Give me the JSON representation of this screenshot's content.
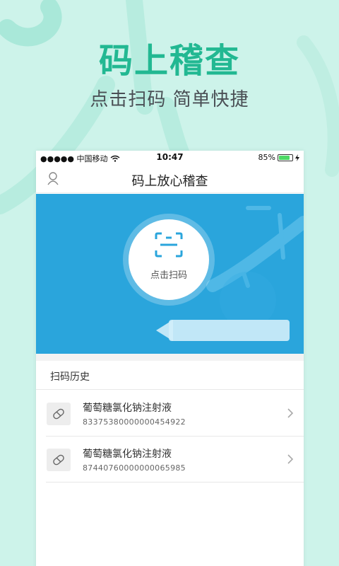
{
  "hero": {
    "title": "码上稽查",
    "subtitle": "点击扫码  简单快捷"
  },
  "status_bar": {
    "carrier": "●●●●● 中国移动",
    "time": "10:47",
    "battery": "85%",
    "battery_level": 0.85
  },
  "nav": {
    "title": "码上放心稽查",
    "user_icon": "user-icon"
  },
  "scan": {
    "label": "点击扫码",
    "icon": "scan-icon"
  },
  "history": {
    "title": "扫码历史",
    "items": [
      {
        "name": "葡萄糖氯化钠注射液",
        "code": "83375380000000454922",
        "icon": "pill-icon"
      },
      {
        "name": "葡萄糖氯化钠注射液",
        "code": "87440760000000065985",
        "icon": "pill-icon"
      }
    ]
  },
  "colors": {
    "hero_title": "#22b892",
    "background": "#cdf3ea",
    "scan_panel": "#2aa5dc"
  }
}
